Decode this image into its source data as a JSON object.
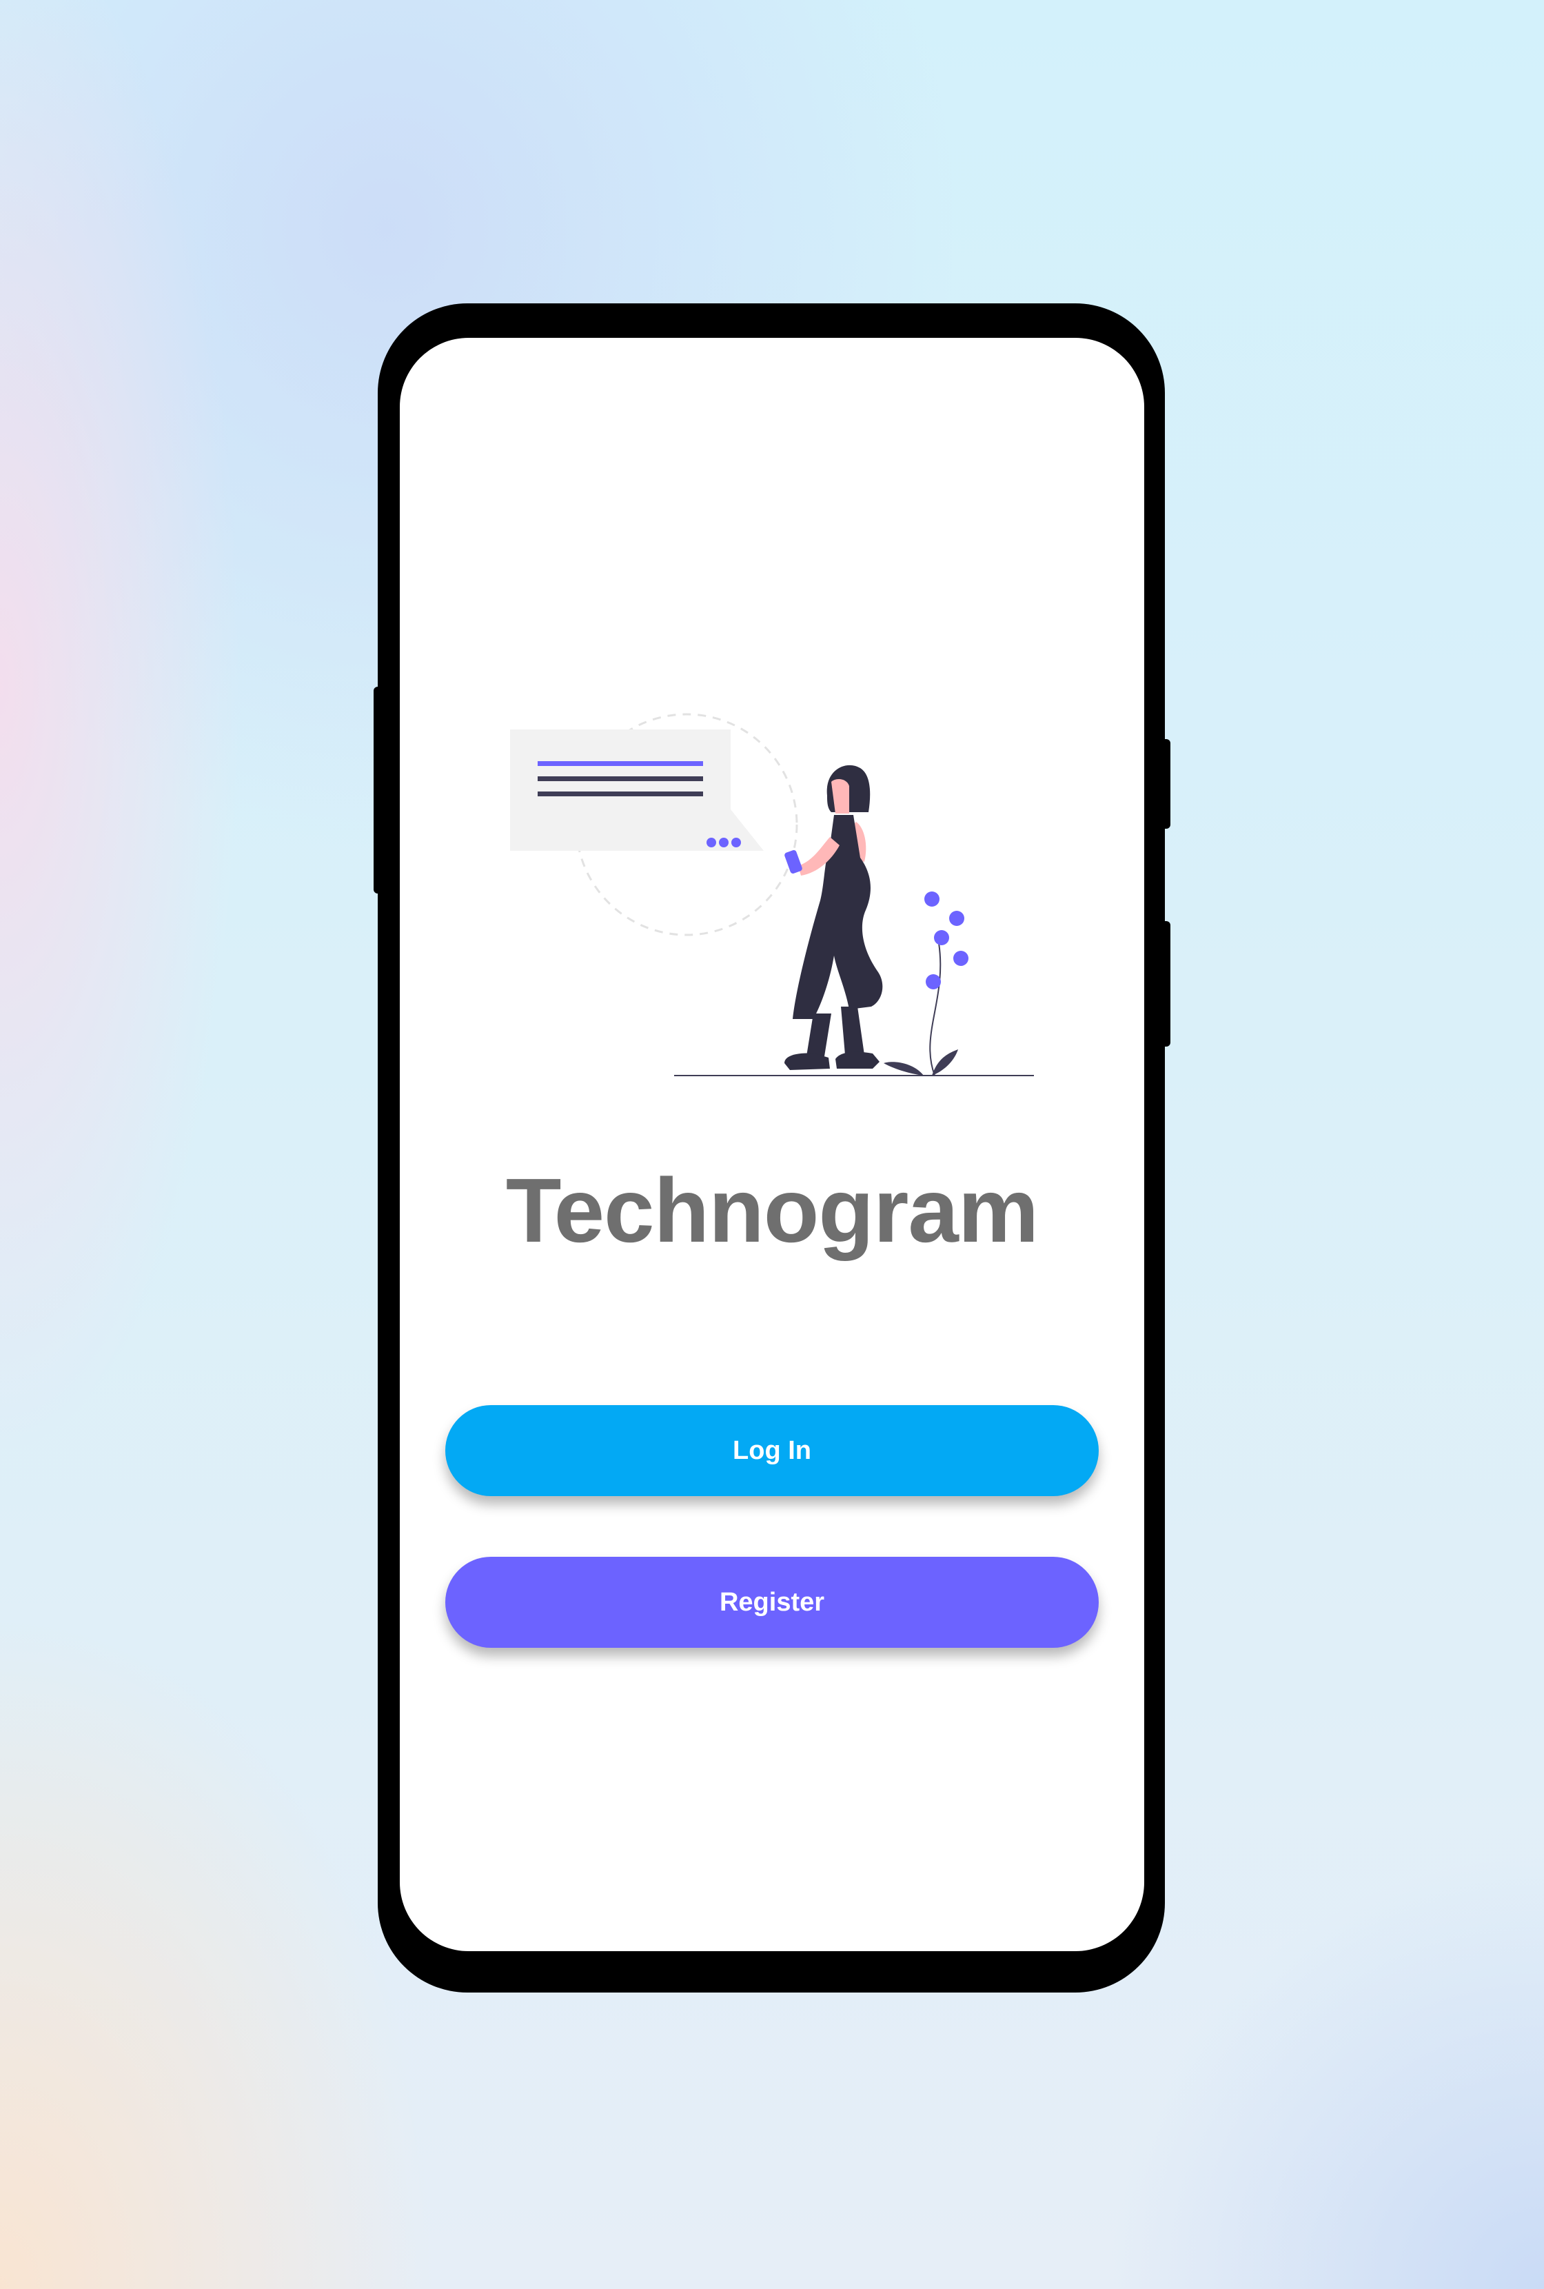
{
  "app": {
    "title": "Technogram"
  },
  "buttons": {
    "login_label": "Log In",
    "register_label": "Register"
  },
  "illustration": {
    "icon": "woman-with-phone-chat-illustration",
    "accent_color": "#6c63ff"
  },
  "colors": {
    "login_button": "#03a9f4",
    "register_button": "#6c63ff",
    "title_text": "#6f6f6f",
    "phone_frame": "#000000",
    "screen_background": "#ffffff"
  }
}
